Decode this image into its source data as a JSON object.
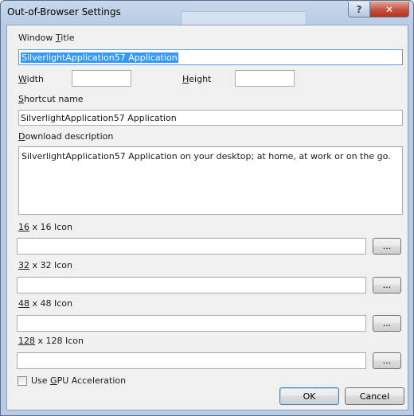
{
  "window": {
    "title": "Out-of-Browser Settings",
    "help_glyph": "?",
    "close_glyph": "✕"
  },
  "form": {
    "window_title_label_pre": "Window ",
    "window_title_label_key": "T",
    "window_title_label_post": "itle",
    "window_title_value": "SilverlightApplication57 Application",
    "width_label_key": "W",
    "width_label_post": "idth",
    "width_value": "",
    "height_label_key": "H",
    "height_label_post": "eight",
    "height_value": "",
    "shortcut_label_key": "S",
    "shortcut_label_post": "hortcut name",
    "shortcut_value": "SilverlightApplication57 Application",
    "description_label_key": "D",
    "description_label_post": "ownload description",
    "description_value": "SilverlightApplication57 Application on your desktop; at home, at work or on the go.",
    "icons": [
      {
        "label_key": "16",
        "label_post": " x 16 Icon",
        "value": "",
        "browse": "..."
      },
      {
        "label_key": "32",
        "label_post": " x 32 Icon",
        "value": "",
        "browse": "..."
      },
      {
        "label_key": "48",
        "label_post": " x 48 Icon",
        "value": "",
        "browse": "..."
      },
      {
        "label_key": "128",
        "label_post": " x 128 Icon",
        "value": "",
        "browse": "..."
      }
    ],
    "gpu_label_pre": "Use ",
    "gpu_label_key": "G",
    "gpu_label_post": "PU Acceleration",
    "gpu_checked": false
  },
  "buttons": {
    "ok": "OK",
    "cancel": "Cancel"
  }
}
